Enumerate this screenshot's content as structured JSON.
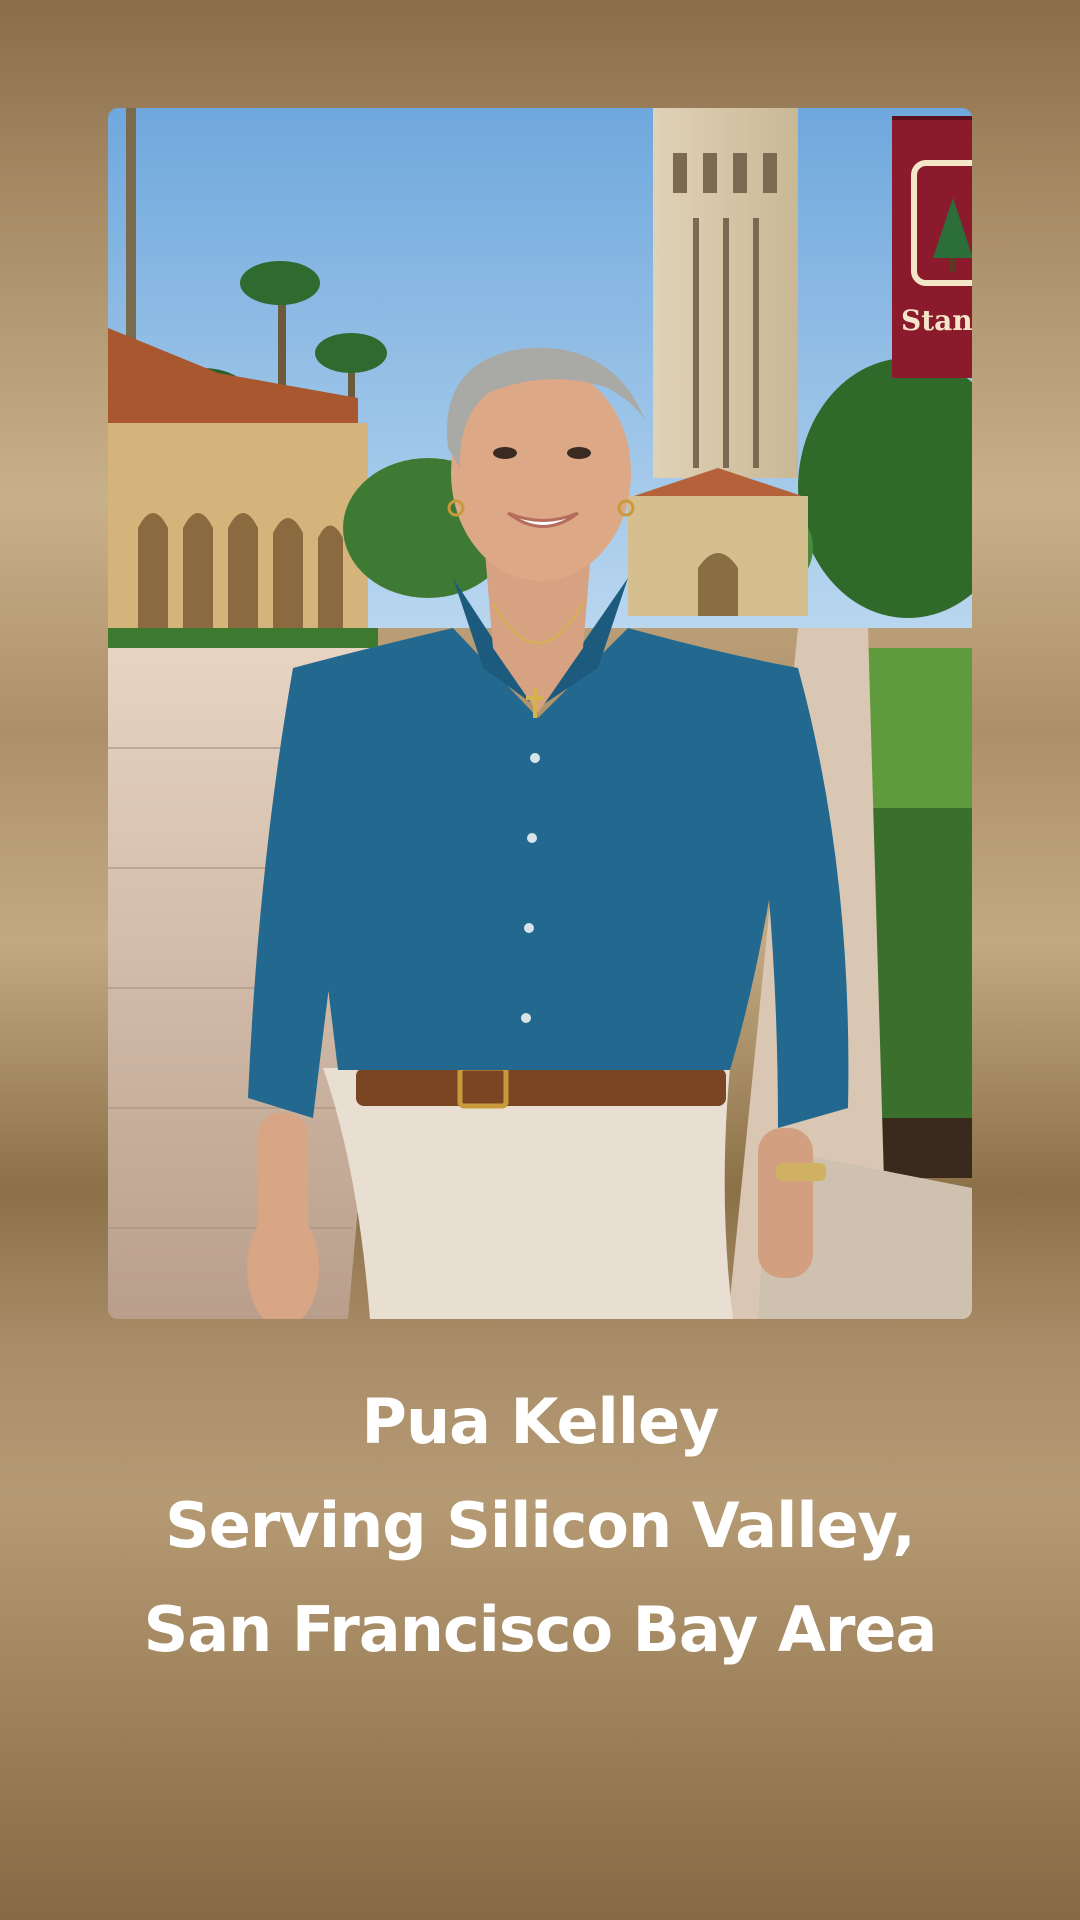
{
  "profile": {
    "name": "Pua Kelley",
    "service_line_1": "Serving Silicon Valley,",
    "service_line_2": "San Francisco Bay Area"
  },
  "photo": {
    "banner_text": "Stanf",
    "icon": "portrait-photo"
  },
  "colors": {
    "text": "#ffffff",
    "background_gold": "#a58a64",
    "shirt_blue": "#23698f",
    "banner_red": "#8b1b2c"
  }
}
